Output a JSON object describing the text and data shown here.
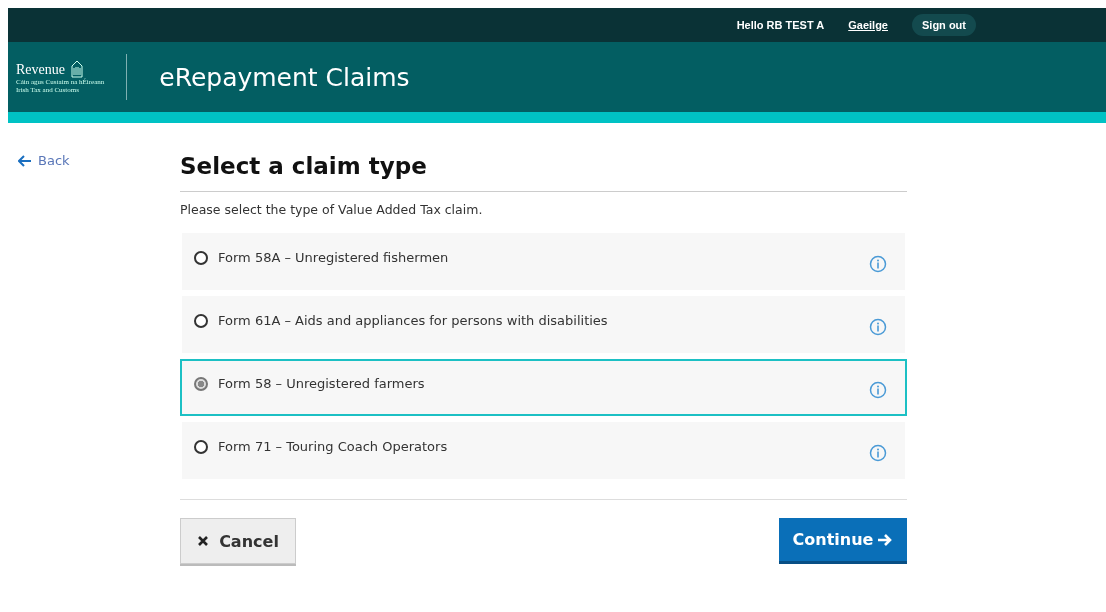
{
  "top_bar": {
    "greeting": "Hello RB TEST A",
    "language_link": "Gaeilge",
    "sign_out": "Sign out"
  },
  "header": {
    "logo": {
      "name": "Revenue",
      "tagline_1": "Cáin agus Custaim na hÉireann",
      "tagline_2": "Irish Tax and Customs"
    },
    "title": "eRepayment Claims"
  },
  "back_link": "Back",
  "page": {
    "heading": "Select a claim type",
    "description": "Please select the type of Value Added Tax claim.",
    "options": [
      {
        "label": "Form 58A – Unregistered fishermen",
        "selected": false
      },
      {
        "label": "Form 61A – Aids and appliances for persons with disabilities",
        "selected": false
      },
      {
        "label": "Form 58 – Unregistered farmers",
        "selected": true
      },
      {
        "label": "Form 71 – Touring Coach Operators",
        "selected": false
      }
    ]
  },
  "buttons": {
    "cancel": "Cancel",
    "continue": "Continue"
  }
}
